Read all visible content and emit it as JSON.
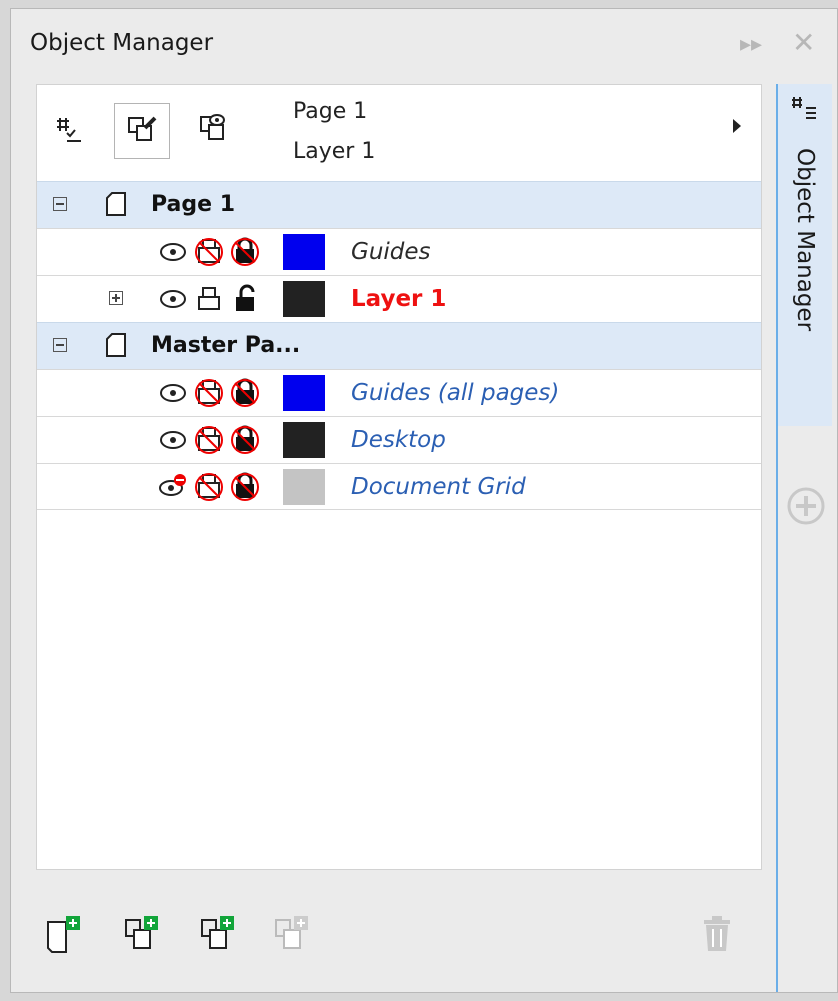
{
  "docker": {
    "title": "Object Manager",
    "side_tab_label": "Object Manager"
  },
  "header": {
    "current_page": "Page 1",
    "current_layer": "Layer 1"
  },
  "tree": {
    "page1": {
      "name": "Page 1",
      "layers": [
        {
          "name": "Guides",
          "color": "#0000ee",
          "style": "dark-italic"
        },
        {
          "name": "Layer 1",
          "color": "#222222",
          "style": "active"
        }
      ]
    },
    "master": {
      "name": "Master Pa...",
      "layers": [
        {
          "name": "Guides (all pages)",
          "color": "#0000ee",
          "style": "link"
        },
        {
          "name": "Desktop",
          "color": "#222222",
          "style": "link"
        },
        {
          "name": "Document Grid",
          "color": "#c4c4c4",
          "style": "link"
        }
      ]
    }
  },
  "colors": {
    "accent": "#6aaee8",
    "page_row_bg": "#dde9f7",
    "active_layer": "#ee1111",
    "add_green": "#12a53a"
  },
  "icons": {
    "view_toggle": "eye-icon",
    "print_toggle": "printer-icon",
    "lock_toggle": "lock-icon",
    "delete": "trash-icon"
  }
}
